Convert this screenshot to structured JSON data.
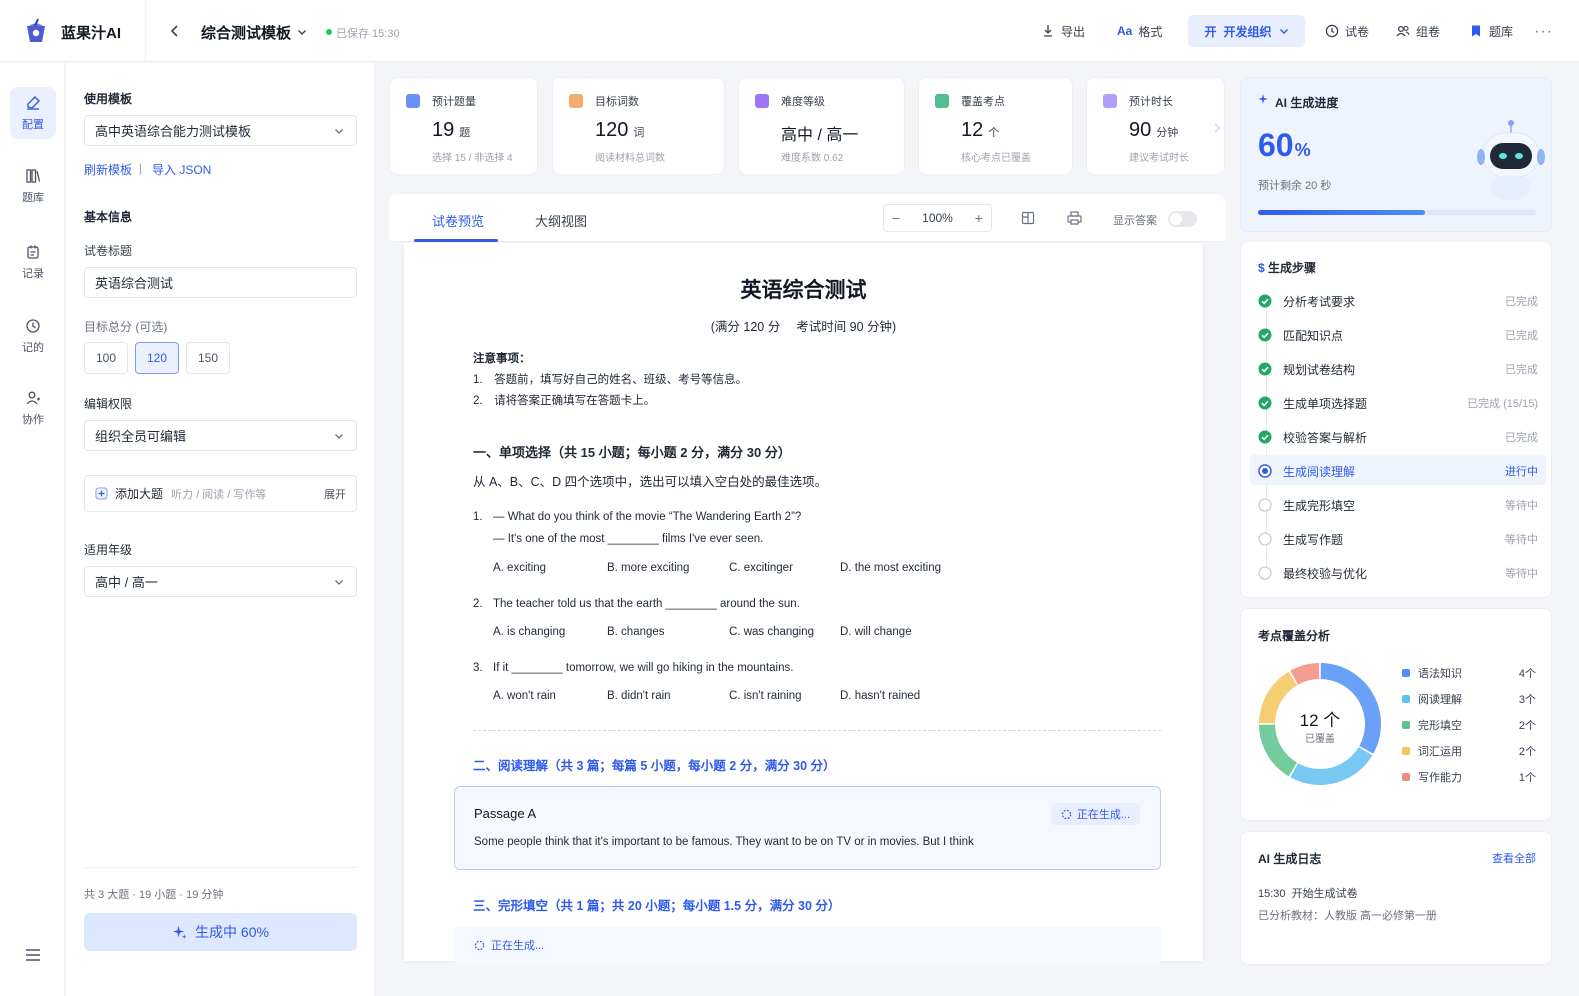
{
  "header": {
    "brand": "蓝果汁AI",
    "doc_title": "综合测试模板",
    "saved": "已保存 15:30",
    "export": "导出",
    "format": "格式",
    "org": "开发组织",
    "org_glyph": "开",
    "paper": "试卷",
    "group": "组卷",
    "bank": "题库",
    "more": "···"
  },
  "nav": [
    {
      "label": "配置",
      "icon": "config-icon"
    },
    {
      "label": "题库",
      "icon": "library-icon"
    },
    {
      "label": "记录",
      "icon": "record-icon"
    },
    {
      "label": "记的",
      "icon": "clock-icon"
    },
    {
      "label": "协作",
      "icon": "people-icon"
    }
  ],
  "config": {
    "template_label": "使用模板",
    "template_value": "高中英语综合能力测试模板",
    "refresh": "刷新模板",
    "sep": "|",
    "import_json": "导入 JSON",
    "basic_info": "基本信息",
    "title_label": "试卷标题",
    "title_value": "英语综合测试",
    "score_label": "目标总分 (可选)",
    "scores": [
      "100",
      "120",
      "150"
    ],
    "perm_label": "编辑权限",
    "perm_value": "组织全员可编辑",
    "add_section": "添加大题",
    "add_hint": "听力 / 阅读 / 写作等",
    "expand": "展开",
    "grade_label": "适用年级",
    "grade_value": "高中 / 高一",
    "summary": "共 3 大题 · 19 小题 · 19 分钟",
    "generate": "生成中 60%"
  },
  "stats": [
    {
      "title": "预计题量",
      "value": "19",
      "unit": "题",
      "sub": "选择 15 / 非选择 4",
      "color": "#4f7cf5"
    },
    {
      "title": "目标词数",
      "value": "120",
      "unit": "词",
      "sub": "阅读材料总词数",
      "color": "#f59e5b"
    },
    {
      "title": "难度等级",
      "value": "高中 / 高一",
      "unit": "",
      "sub": "难度系数 0.62",
      "color": "#8b5cf6"
    },
    {
      "title": "覆盖考点",
      "value": "12",
      "unit": "个",
      "sub": "核心考点已覆盖",
      "color": "#34b27a"
    },
    {
      "title": "预计时长",
      "value": "90",
      "unit": "分钟",
      "sub": "建议考试时长",
      "color": "#a78bfa"
    }
  ],
  "preview": {
    "tab_preview": "试卷预览",
    "tab_outline": "大纲视图",
    "zoom": "100%",
    "zoom_minus": "−",
    "zoom_plus": "+",
    "show_answer": "显示答案",
    "show_answer_on": false
  },
  "paper": {
    "title": "英语综合测试",
    "subtitle": "(满分 120 分　 考试时间 90 分钟)",
    "notes_title": "注意事项：",
    "notes": [
      "1.　答题前，填写好自己的姓名、班级、考号等信息。",
      "2.　请将答案正确填写在答题卡上。"
    ],
    "sec1_title": "一、单项选择（共 15 小题；每小题 2 分，满分 30 分）",
    "sec1_desc": "从 A、B、C、D 四个选项中，选出可以填入空白处的最佳选项。",
    "questions": [
      {
        "num": "1.",
        "lines": [
          "— What do you think of the movie “The Wandering Earth 2”?",
          "— It's one of the most ________ films I've ever seen."
        ],
        "opts": [
          "A. exciting",
          "B. more exciting",
          "C. excitinger",
          "D. the most exciting"
        ]
      },
      {
        "num": "2.",
        "lines": [
          "The teacher told us that the earth ________ around the sun."
        ],
        "opts": [
          "A. is changing",
          "B. changes",
          "C. was changing",
          "D. will change"
        ]
      },
      {
        "num": "3.",
        "lines": [
          "If it ________ tomorrow, we will go hiking in the mountains."
        ],
        "opts": [
          "A. won't rain",
          "B. didn't rain",
          "C. isn't raining",
          "D. hasn't rained"
        ]
      }
    ],
    "sec2_title": "二、阅读理解（共 3 篇；每篇 5 小题，每小题 2 分，满分 30 分）",
    "passage_title": "Passage A",
    "passage_status": "正在生成...",
    "passage_text": "Some people think that it's important to be famous. They want to be on TV or in movies. But I think",
    "sec3_title": "三、完形填空（共 1 篇；共 20 小题；每小题 1.5 分，满分 30 分）",
    "sec3_status": "正在生成..."
  },
  "progress": {
    "title": "AI 生成进度",
    "percent": "60",
    "percent_sign": "%",
    "fraction": 0.6,
    "remaining": "预计剩余 20 秒"
  },
  "steps": {
    "title": "生成步骤",
    "items": [
      {
        "label": "分析考试要求",
        "status": "已完成",
        "state": "done"
      },
      {
        "label": "匹配知识点",
        "status": "已完成",
        "state": "done"
      },
      {
        "label": "规划试卷结构",
        "status": "已完成",
        "state": "done"
      },
      {
        "label": "生成单项选择题",
        "status": "已完成 (15/15)",
        "state": "done"
      },
      {
        "label": "校验答案与解析",
        "status": "已完成",
        "state": "done"
      },
      {
        "label": "生成阅读理解",
        "status": "进行中",
        "state": "active"
      },
      {
        "label": "生成完形填空",
        "status": "等待中",
        "state": "pending"
      },
      {
        "label": "生成写作题",
        "status": "等待中",
        "state": "pending"
      },
      {
        "label": "最终校验与优化",
        "status": "等待中",
        "state": "pending"
      }
    ]
  },
  "coverage": {
    "title": "考点覆盖分析",
    "center_value": "12 个",
    "center_label": "已覆盖",
    "items": [
      {
        "label": "语法知识",
        "count": "4个",
        "value": 4,
        "color": "#4f8ff7"
      },
      {
        "label": "阅读理解",
        "count": "3个",
        "value": 3,
        "color": "#60c0f0"
      },
      {
        "label": "完形填空",
        "count": "2个",
        "value": 2,
        "color": "#5cc28a"
      },
      {
        "label": "词汇运用",
        "count": "2个",
        "value": 2,
        "color": "#f3c45a"
      },
      {
        "label": "写作能力",
        "count": "1个",
        "value": 1,
        "color": "#f08c7c"
      }
    ]
  },
  "log": {
    "title": "AI 生成日志",
    "view_all": "查看全部",
    "time": "15:30",
    "entry": "开始生成试卷",
    "detail": "已分析教材：人教版 高一必修第一册"
  }
}
